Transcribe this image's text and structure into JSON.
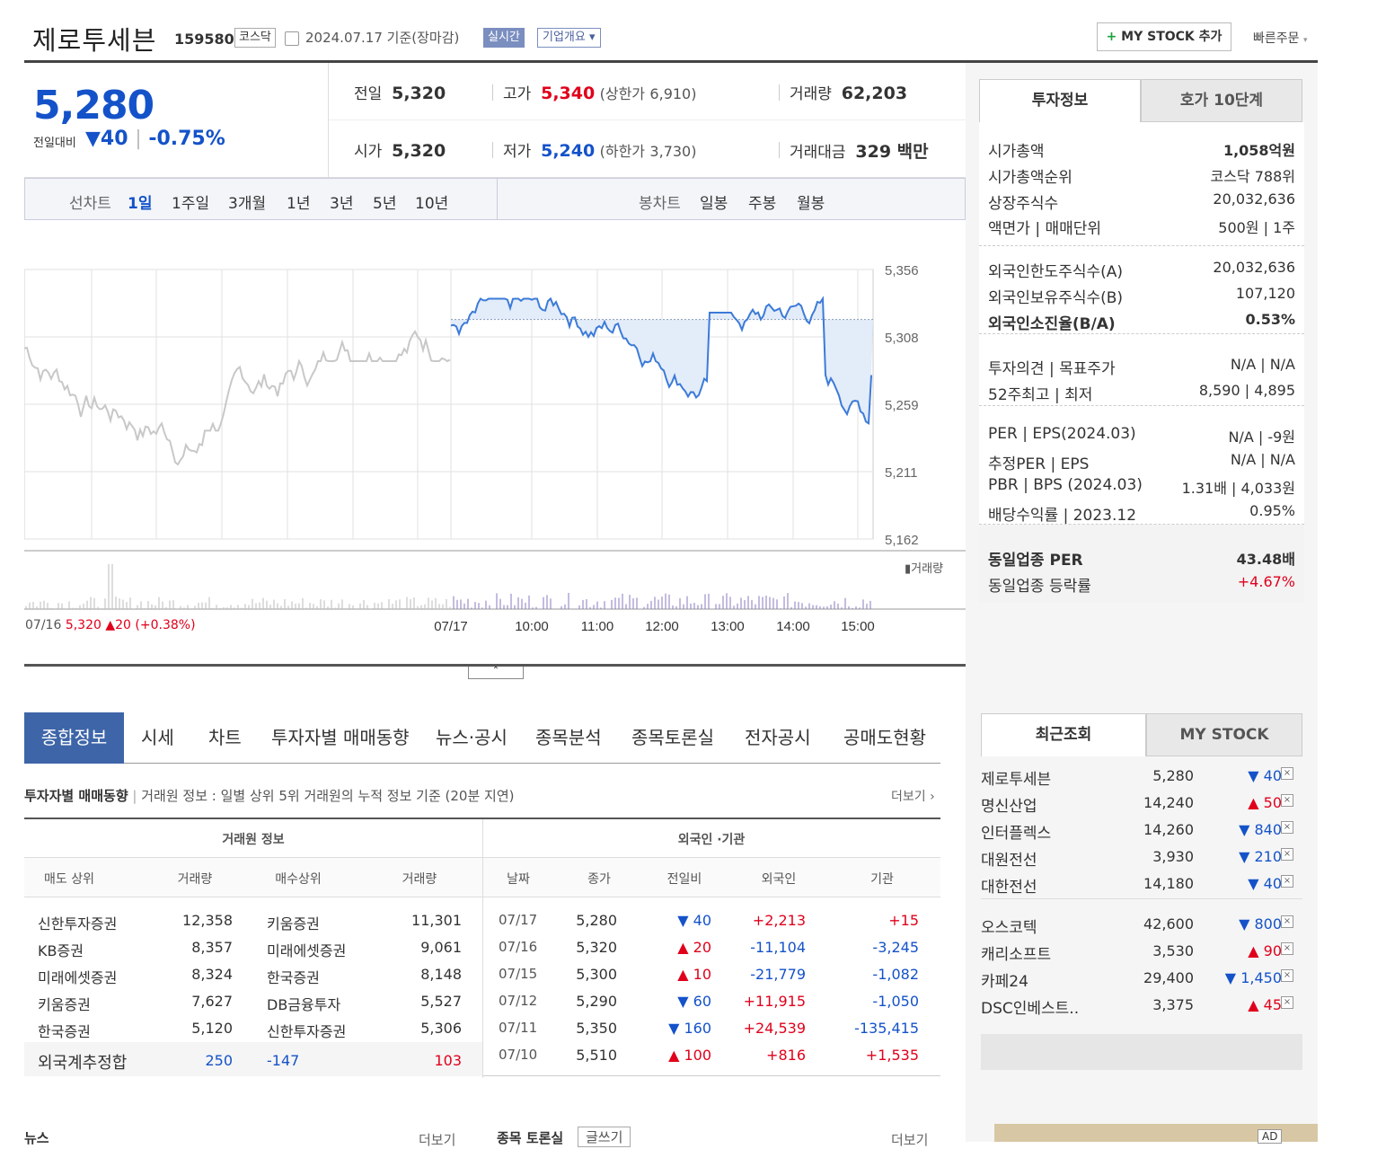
{
  "header": {
    "title": "제로투세븐",
    "code": "159580",
    "market": "코스닥",
    "date": "2024.07.17",
    "basis": "기준(장마감)",
    "live": "실시간",
    "corp": "기업개요",
    "mystock": "MY STOCK 추가",
    "fast": "빠른주문"
  },
  "price": {
    "now": "5,280",
    "change_label": "전일대비",
    "change": "40",
    "rate": "-0.75%",
    "prev_label": "전일",
    "prev": "5,320",
    "open_label": "시가",
    "open": "5,320",
    "high_label": "고가",
    "high": "5,340",
    "upper_label": "(상한가",
    "upper": "6,910)",
    "low_label": "저가",
    "low": "5,240",
    "lower_label": "(하한가",
    "lower": "3,730)",
    "vol_label": "거래량",
    "vol": "62,203",
    "amt_label": "거래대금",
    "amt": "329 백만"
  },
  "chart_tabs": {
    "line_label": "선차트",
    "line": [
      "1일",
      "1주일",
      "3개월",
      "1년",
      "3년",
      "5년",
      "10년"
    ],
    "candle_label": "봉차트",
    "candle": [
      "일봉",
      "주봉",
      "월봉"
    ]
  },
  "chart_data": {
    "type": "line",
    "yticks": [
      "5,356",
      "5,308",
      "5,259",
      "5,211",
      "5,162"
    ],
    "xticks": [
      "07/17",
      "10:00",
      "11:00",
      "12:00",
      "13:00",
      "14:00",
      "15:00"
    ],
    "prev_close": 5320,
    "ylim": [
      5162,
      5356
    ],
    "volume_label": "거래량",
    "prev_day": "07/16",
    "prev_price": "5,320",
    "prev_change": "20",
    "prev_rate": "(+0.38%)"
  },
  "side_tabs": [
    "투자정보",
    "호가 10단계"
  ],
  "invest": [
    {
      "k": "시가총액",
      "v": "1,058억원"
    },
    {
      "k": "시가총액순위",
      "v": "코스닥 788위"
    },
    {
      "k": "상장주식수",
      "v": "20,032,636"
    },
    {
      "k": "액면가 | 매매단위",
      "v": "500원 | 1주"
    },
    {
      "k": "외국인한도주식수(A)",
      "v": "20,032,636"
    },
    {
      "k": "외국인보유주식수(B)",
      "v": "107,120"
    },
    {
      "k": "외국인소진율(B/A)",
      "v": "0.53%"
    },
    {
      "k": "투자의견 | 목표주가",
      "v": "N/A | N/A"
    },
    {
      "k": "52주최고 | 최저",
      "v": "8,590 | 4,895"
    },
    {
      "k": "PER | EPS(2024.03)",
      "v": "N/A | -9원"
    },
    {
      "k": "추정PER | EPS",
      "v": "N/A | N/A"
    },
    {
      "k": "PBR | BPS (2024.03)",
      "v": "1.31배 | 4,033원"
    },
    {
      "k": "배당수익률 | 2023.12",
      "v": "0.95%"
    },
    {
      "k": "동일업종 PER",
      "v": "43.48배"
    },
    {
      "k": "동일업종 등락률",
      "v": "+4.67%"
    }
  ],
  "nav": [
    "종합정보",
    "시세",
    "차트",
    "투자자별 매매동향",
    "뉴스·공시",
    "종목분석",
    "종목토론실",
    "전자공시",
    "공매도현황"
  ],
  "section": {
    "title": "투자자별 매매동향",
    "desc": "거래원 정보 : 일별 상위 5위 거래원의 누적 정보 기준 (20분 지연)",
    "more": "더보기"
  },
  "broker": {
    "head": "거래원 정보",
    "cols": [
      "매도 상위",
      "거래량",
      "매수상위",
      "거래량"
    ],
    "rows": [
      [
        "신한투자증권",
        "12,358",
        "키움증권",
        "11,301"
      ],
      [
        "KB증권",
        "8,357",
        "미래에셋증권",
        "9,061"
      ],
      [
        "미래에셋증권",
        "8,324",
        "한국증권",
        "8,148"
      ],
      [
        "키움증권",
        "7,627",
        "DB금융투자",
        "5,527"
      ],
      [
        "한국증권",
        "5,120",
        "신한투자증권",
        "5,306"
      ]
    ],
    "foreign": [
      "외국계추정합",
      "250",
      "-147",
      "103"
    ]
  },
  "foreigner": {
    "head": "외국인 ·기관",
    "cols": [
      "날짜",
      "종가",
      "전일비",
      "외국인",
      "기관"
    ],
    "rows": [
      [
        "07/17",
        "5,280",
        "▼ 40",
        "+2,213",
        "+15"
      ],
      [
        "07/16",
        "5,320",
        "▲ 20",
        "-11,104",
        "-3,245"
      ],
      [
        "07/15",
        "5,300",
        "▲ 10",
        "-21,779",
        "-1,082"
      ],
      [
        "07/12",
        "5,290",
        "▼ 60",
        "+11,915",
        "-1,050"
      ],
      [
        "07/11",
        "5,350",
        "▼ 160",
        "+24,539",
        "-135,415"
      ],
      [
        "07/10",
        "5,510",
        "▲ 100",
        "+816",
        "+1,535"
      ]
    ]
  },
  "recent_tabs": [
    "최근조회",
    "MY STOCK"
  ],
  "recent": [
    [
      "제로투세븐",
      "5,280",
      "▼ 40"
    ],
    [
      "명신산업",
      "14,240",
      "▲ 50"
    ],
    [
      "인터플렉스",
      "14,260",
      "▼ 840"
    ],
    [
      "대원전선",
      "3,930",
      "▼ 210"
    ],
    [
      "대한전선",
      "14,180",
      "▼ 40"
    ],
    [
      "오스코텍",
      "42,600",
      "▼ 800"
    ],
    [
      "캐리소프트",
      "3,530",
      "▲ 90"
    ],
    [
      "카페24",
      "29,400",
      "▼ 1,450"
    ],
    [
      "DSC인베스트..",
      "3,375",
      "▲ 45"
    ]
  ],
  "footer": {
    "news": "뉴스",
    "more1": "더보기",
    "board": "종목 토론실",
    "write": "글쓰기",
    "more2": "더보기",
    "ad": "AD"
  }
}
